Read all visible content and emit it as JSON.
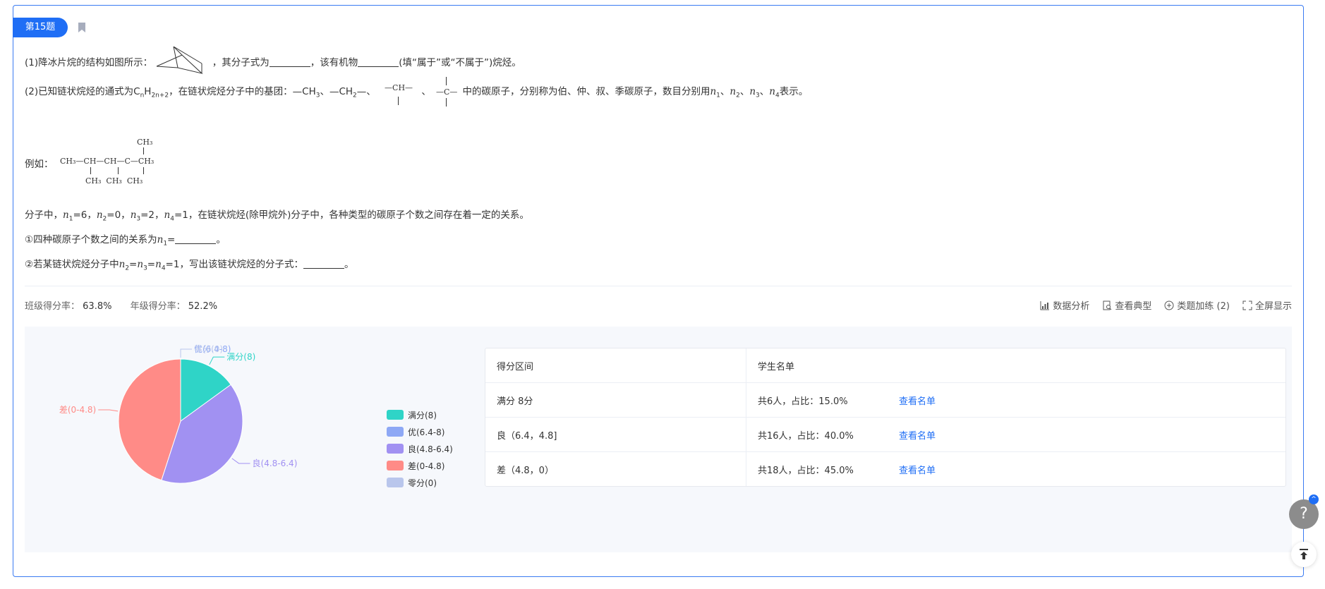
{
  "question": {
    "badge": "第15题",
    "line1": {
      "prefix": "(1)降冰片烷的结构如图所示：",
      "mid": "，其分子式为",
      "mid2": "，该有机物",
      "suffix": "(填“属于”或“不属于”)烷烃。"
    },
    "line2": {
      "prefix": "(2)已知链状烷烃的通式为C",
      "sub_n": "n",
      "h": "H",
      "sub_2n2": "2n+2",
      "mid": "，在链状烷烃分子中的基团：—CH",
      "sub3": "3",
      "mid2": "、—CH",
      "sub2": "2",
      "mid3": "—、",
      "group_ch": "—CH—",
      "sep": "、",
      "group_c": "—C—",
      "suffix": "中的碳原子，分别称为伯、仲、叔、季碳原子，数目分别用",
      "n": "n",
      "s1": "1",
      "s2": "2",
      "s3": "3",
      "s4": "4",
      "comma": "、",
      "end": "表示。"
    },
    "example": {
      "label": "例如：",
      "main": "CH₃—CH—CH—C—CH₃",
      "top": "CH₃",
      "bottom": "CH₃  CH₃  CH₃"
    },
    "line3": {
      "prefix": "分子中，",
      "n1": "n",
      "v1": "=6，",
      "v2": "=0，",
      "v3": "=2，",
      "v4": "=1，在链状烷烃(除甲烷外)分子中，各种类型的碳原子个数之间存在着一定的关系。"
    },
    "q1": {
      "prefix": "①四种碳原子个数之间的关系为",
      "n": "n",
      "s": "1",
      "eq": "=",
      "end": "。"
    },
    "q2": {
      "prefix": "②若某链状烷烃分子中",
      "n": "n",
      "s2": "2",
      "eq": "=",
      "s3": "3",
      "s4": "4",
      "val": "=1，写出该链状烷烃的分子式：",
      "end": "。"
    }
  },
  "stats": {
    "class_label": "班级得分率：",
    "class_value": "63.8%",
    "grade_label": "年级得分率：",
    "grade_value": "52.2%"
  },
  "tools": {
    "data_analysis": "数据分析",
    "view_typical": "查看典型",
    "similar_practice": "类题加练 (2)",
    "fullscreen": "全屏显示"
  },
  "chart_data": {
    "type": "pie",
    "series": [
      {
        "name": "满分(8)",
        "value": 15.0,
        "color": "#2fd4c7"
      },
      {
        "name": "良(4.8-6.4)",
        "value": 40.0,
        "color": "#a191f2"
      },
      {
        "name": "差(0-4.8)",
        "value": 45.0,
        "color": "#ff8b87"
      },
      {
        "name": "优(6.4-8)",
        "value": 0,
        "color": "#8ea8f5"
      },
      {
        "name": "零分(0)",
        "value": 0,
        "color": "#b9c6ec"
      }
    ],
    "legend": [
      "满分(8)",
      "优(6.4-8)",
      "良(4.8-6.4)",
      "差(0-4.8)",
      "零分(0)"
    ],
    "legend_position": "right"
  },
  "table": {
    "headers": [
      "得分区间",
      "学生名单"
    ],
    "rows": [
      {
        "range": "满分 8分",
        "count": "共6人，占比：15.0%",
        "link": "查看名单"
      },
      {
        "range": "良（6.4，4.8]",
        "count": "共16人，占比：40.0%",
        "link": "查看名单"
      },
      {
        "range": "差（4.8，0）",
        "count": "共18人，占比：45.0%",
        "link": "查看名单"
      }
    ]
  },
  "help": {
    "label": "?",
    "up": "^"
  },
  "colors": {
    "accent": "#1f6ef5",
    "border": "#3a7bf2"
  }
}
